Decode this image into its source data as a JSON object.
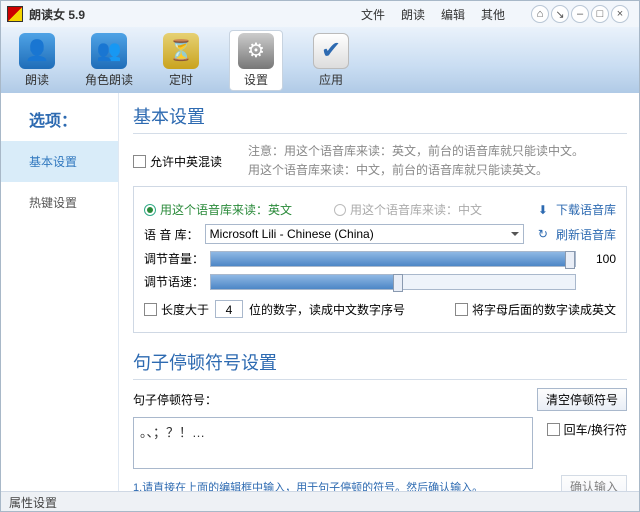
{
  "window": {
    "title": "朗读女  5.9"
  },
  "menu": {
    "file": "文件",
    "read": "朗读",
    "edit": "编辑",
    "other": "其他"
  },
  "toolbar": {
    "read": "朗读",
    "role_read": "角色朗读",
    "timer": "定时",
    "settings": "设置",
    "apply": "应用"
  },
  "sidebar": {
    "title": "选项：",
    "items": [
      "基本设置",
      "热键设置"
    ],
    "active_index": 0
  },
  "basic": {
    "title": "基本设置",
    "mix_label": "允许中英混读",
    "note1": "注意：用这个语音库来读：英文，前台的语音库就只能读中文。",
    "note2": "用这个语音库来读：中文，前台的语音库就只能读英文。",
    "radio_en": "用这个语音库来读：英文",
    "radio_cn": "用这个语音库来读：中文",
    "download": "下载语音库",
    "voice_label": "语 音 库：",
    "voice_value": "Microsoft Lili - Chinese (China)",
    "refresh": "刷新语音库",
    "vol_label": "调节音量：",
    "vol_value": "100",
    "speed_label": "调节语速：",
    "len_label_a": "长度大于",
    "len_value": "4",
    "len_label_b": "位的数字，读成中文数字序号",
    "letter_digit": "将字母后面的数字读成英文"
  },
  "pause": {
    "title": "句子停顿符号设置",
    "label": "句子停顿符号：",
    "clear": "清空停顿符号",
    "symbols": "。、；？！…",
    "enter": "回车/换行符",
    "hint": "1.请直接在上面的编辑框中输入，用于句子停顿的符号。然后确认输入。",
    "confirm": "确认输入"
  },
  "status": {
    "text": "属性设置"
  }
}
